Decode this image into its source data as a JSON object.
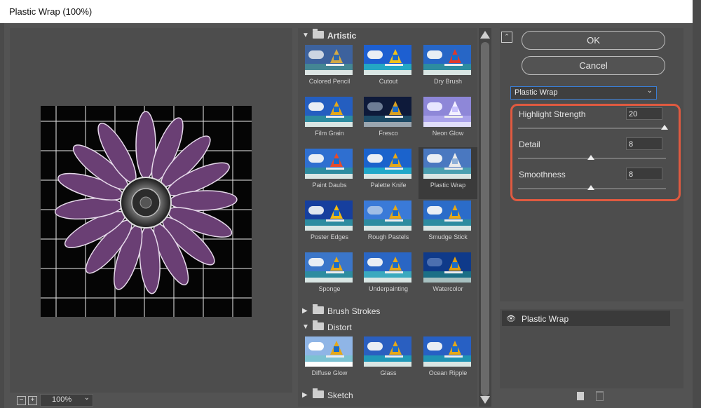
{
  "window": {
    "title": "Plastic Wrap (100%)"
  },
  "preview": {
    "zoom_value": "100%",
    "zoom_out_label": "−",
    "zoom_in_label": "+"
  },
  "gallery": {
    "categories": [
      {
        "label": "Artistic",
        "expanded": true
      },
      {
        "label": "Brush Strokes",
        "expanded": false
      },
      {
        "label": "Distort",
        "expanded": true
      },
      {
        "label": "Sketch",
        "expanded": false
      }
    ],
    "artistic_items": [
      "Colored Pencil",
      "Cutout",
      "Dry Brush",
      "Film Grain",
      "Fresco",
      "Neon Glow",
      "Paint Daubs",
      "Palette Knife",
      "Plastic Wrap",
      "Poster Edges",
      "Rough Pastels",
      "Smudge Stick",
      "Sponge",
      "Underpainting",
      "Watercolor"
    ],
    "distort_items": [
      "Diffuse Glow",
      "Glass",
      "Ocean Ripple"
    ],
    "selected": "Plastic Wrap"
  },
  "buttons": {
    "ok": "OK",
    "cancel": "Cancel"
  },
  "filter_select": {
    "value": "Plastic Wrap"
  },
  "params": [
    {
      "label": "Highlight Strength",
      "value": "20",
      "level": 1.0
    },
    {
      "label": "Detail",
      "value": "8",
      "level": 0.5
    },
    {
      "label": "Smoothness",
      "value": "8",
      "level": 0.5
    }
  ],
  "layers": [
    {
      "label": "Plastic Wrap",
      "visible": true
    }
  ],
  "colors": {
    "highlight_box": "#e05a40",
    "focus_border": "#3a7ed4",
    "flower": "#6a3f74"
  }
}
